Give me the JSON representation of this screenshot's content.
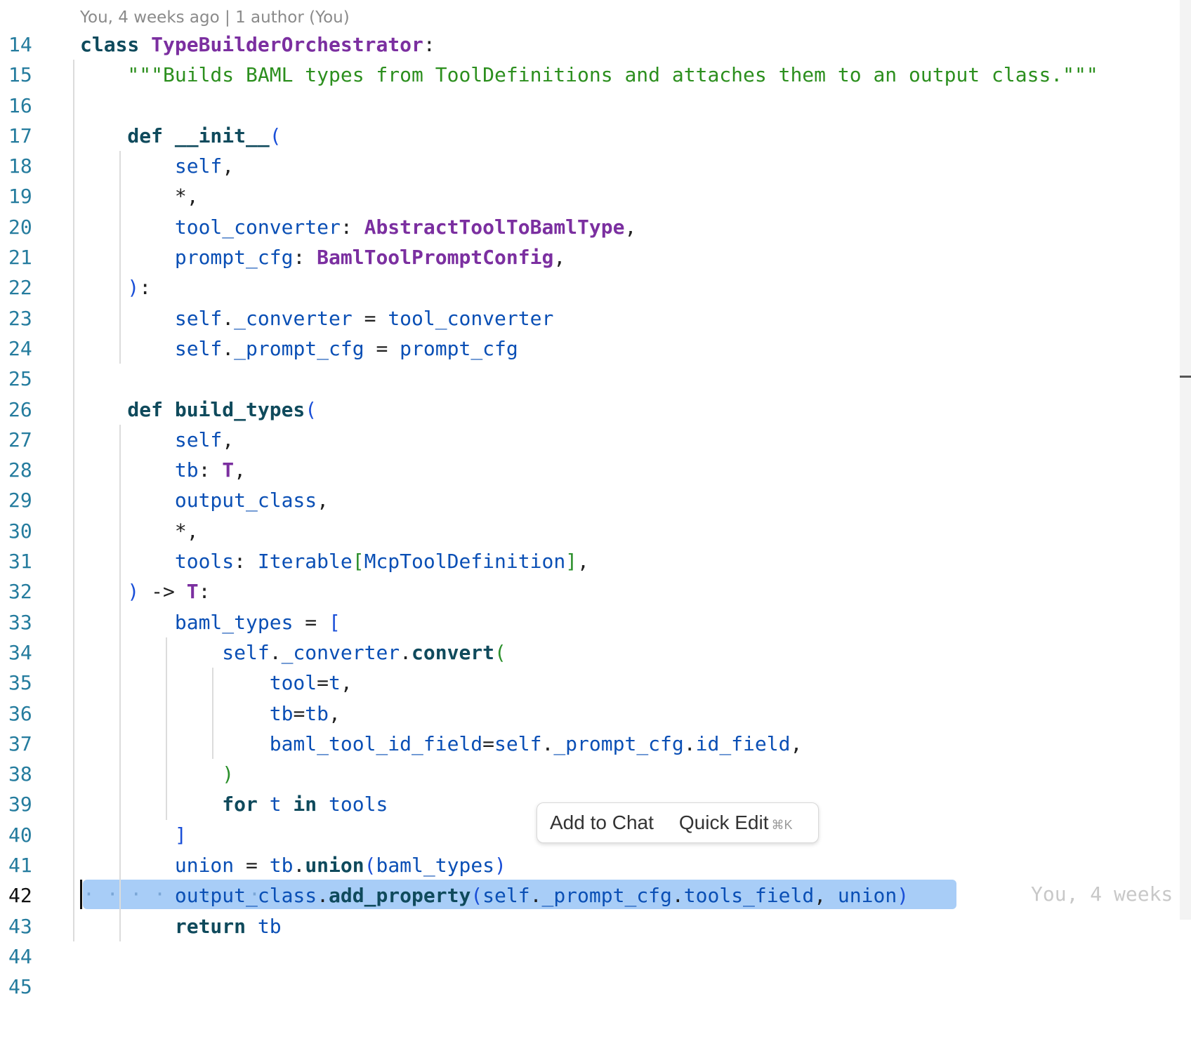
{
  "codelens": "You, 4 weeks ago | 1 author (You)",
  "inline_blame": "You, 4 weeks",
  "current_line": 42,
  "popup": {
    "add_to_chat": "Add to Chat",
    "quick_edit": "Quick Edit",
    "shortcut": "⌘K"
  },
  "line_numbers": [
    "14",
    "15",
    "16",
    "17",
    "18",
    "19",
    "20",
    "21",
    "22",
    "23",
    "24",
    "25",
    "26",
    "27",
    "28",
    "29",
    "30",
    "31",
    "32",
    "33",
    "34",
    "35",
    "36",
    "37",
    "38",
    "39",
    "40",
    "41",
    "42",
    "43",
    "44",
    "45"
  ],
  "lines": [
    [
      [
        "kw",
        "class "
      ],
      [
        "cls",
        "TypeBuilderOrchestrator"
      ],
      [
        "pun",
        ":"
      ]
    ],
    [
      [
        "str",
        "    \"\"\"Builds BAML types from ToolDefinitions and attaches them to an output class.\"\"\""
      ]
    ],
    [],
    [
      [
        "kw",
        "    def "
      ],
      [
        "fn",
        "__init__"
      ],
      [
        "pb",
        "("
      ]
    ],
    [
      [
        "var",
        "        self"
      ],
      [
        "pun",
        ","
      ]
    ],
    [
      [
        "pun",
        "        *,"
      ]
    ],
    [
      [
        "var",
        "        tool_converter"
      ],
      [
        "pun",
        ": "
      ],
      [
        "cls",
        "AbstractToolToBamlType"
      ],
      [
        "pun",
        ","
      ]
    ],
    [
      [
        "var",
        "        prompt_cfg"
      ],
      [
        "pun",
        ": "
      ],
      [
        "cls",
        "BamlToolPromptConfig"
      ],
      [
        "pun",
        ","
      ]
    ],
    [
      [
        "pb",
        "    )"
      ],
      [
        "pun",
        ":"
      ]
    ],
    [
      [
        "var",
        "        self"
      ],
      [
        "pun",
        "."
      ],
      [
        "var",
        "_converter"
      ],
      [
        "pun",
        " = "
      ],
      [
        "var",
        "tool_converter"
      ]
    ],
    [
      [
        "var",
        "        self"
      ],
      [
        "pun",
        "."
      ],
      [
        "var",
        "_prompt_cfg"
      ],
      [
        "pun",
        " = "
      ],
      [
        "var",
        "prompt_cfg"
      ]
    ],
    [],
    [
      [
        "kw",
        "    def "
      ],
      [
        "fn",
        "build_types"
      ],
      [
        "pb",
        "("
      ]
    ],
    [
      [
        "var",
        "        self"
      ],
      [
        "pun",
        ","
      ]
    ],
    [
      [
        "var",
        "        tb"
      ],
      [
        "pun",
        ": "
      ],
      [
        "cls",
        "T"
      ],
      [
        "pun",
        ","
      ]
    ],
    [
      [
        "var",
        "        output_class"
      ],
      [
        "pun",
        ","
      ]
    ],
    [
      [
        "pun",
        "        *,"
      ]
    ],
    [
      [
        "var",
        "        tools"
      ],
      [
        "pun",
        ": "
      ],
      [
        "var",
        "Iterable"
      ],
      [
        "pg",
        "["
      ],
      [
        "var",
        "McpToolDefinition"
      ],
      [
        "pg",
        "]"
      ],
      [
        "pun",
        ","
      ]
    ],
    [
      [
        "pb",
        "    )"
      ],
      [
        "pun",
        " -> "
      ],
      [
        "cls",
        "T"
      ],
      [
        "pun",
        ":"
      ]
    ],
    [
      [
        "var",
        "        baml_types"
      ],
      [
        "pun",
        " = "
      ],
      [
        "pb",
        "["
      ]
    ],
    [
      [
        "var",
        "            self"
      ],
      [
        "pun",
        "."
      ],
      [
        "var",
        "_converter"
      ],
      [
        "pun",
        "."
      ],
      [
        "fn",
        "convert"
      ],
      [
        "pg",
        "("
      ]
    ],
    [
      [
        "var",
        "                tool"
      ],
      [
        "pun",
        "="
      ],
      [
        "var",
        "t"
      ],
      [
        "pun",
        ","
      ]
    ],
    [
      [
        "var",
        "                tb"
      ],
      [
        "pun",
        "="
      ],
      [
        "var",
        "tb"
      ],
      [
        "pun",
        ","
      ]
    ],
    [
      [
        "var",
        "                baml_tool_id_field"
      ],
      [
        "pun",
        "="
      ],
      [
        "var",
        "self"
      ],
      [
        "pun",
        "."
      ],
      [
        "var",
        "_prompt_cfg"
      ],
      [
        "pun",
        "."
      ],
      [
        "var",
        "id_field"
      ],
      [
        "pun",
        ","
      ]
    ],
    [
      [
        "pg",
        "            )"
      ]
    ],
    [
      [
        "kw",
        "            for "
      ],
      [
        "var",
        "t"
      ],
      [
        "kw",
        " in "
      ],
      [
        "var",
        "tools"
      ]
    ],
    [
      [
        "pb",
        "        ]"
      ]
    ],
    [
      [
        "var",
        "        union"
      ],
      [
        "pun",
        " = "
      ],
      [
        "var",
        "tb"
      ],
      [
        "pun",
        "."
      ],
      [
        "fn",
        "union"
      ],
      [
        "pb",
        "("
      ],
      [
        "var",
        "baml_types"
      ],
      [
        "pb",
        ")"
      ]
    ],
    [
      [
        "pun",
        "        "
      ],
      [
        "var",
        "output_class"
      ],
      [
        "pun",
        "."
      ],
      [
        "fn",
        "add_property"
      ],
      [
        "pb",
        "("
      ],
      [
        "var",
        "self"
      ],
      [
        "pun",
        "."
      ],
      [
        "var",
        "_prompt_cfg"
      ],
      [
        "pun",
        "."
      ],
      [
        "var",
        "tools_field"
      ],
      [
        "pun",
        ", "
      ],
      [
        "var",
        "union"
      ],
      [
        "pb",
        ")"
      ]
    ],
    [
      [
        "kw",
        "        return "
      ],
      [
        "var",
        "tb"
      ]
    ],
    [],
    []
  ]
}
